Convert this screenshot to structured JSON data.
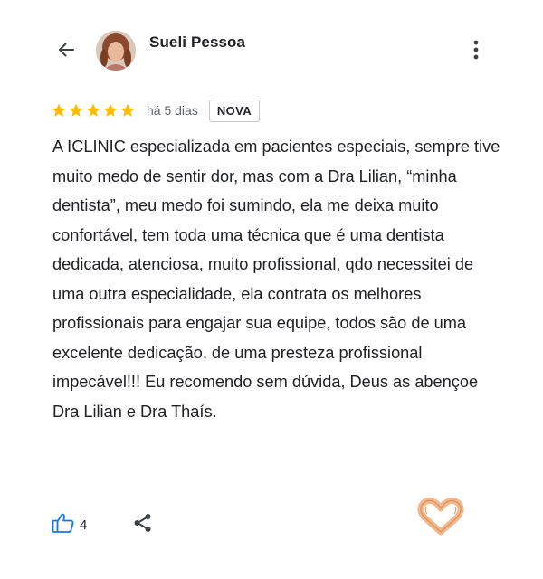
{
  "header": {
    "back_icon": "arrow-left-icon",
    "reviewer_name": "Sueli Pessoa",
    "more_icon": "more-vertical-icon"
  },
  "review": {
    "rating": 5,
    "rating_max": 5,
    "star_color": "#fbbc04",
    "time_ago": "há 5 dias",
    "badge": "NOVA",
    "text": "A ICLINIC especializada em pacientes especiais, sempre tive muito medo de sentir dor, mas com a Dra Lilian, “minha dentista”, meu medo foi sumindo, ela me deixa muito confortável, tem toda uma técnica que é uma dentista dedicada, atenciosa, muito profissional, qdo necessitei de uma outra especialidade, ela contrata os melhores profissionais para engajar sua equipe, todos são de uma excelente dedicação, de uma presteza profissional impecável!!! Eu recomendo sem dúvida, Deus as abençoe Dra Lilian e Dra Thaís."
  },
  "actions": {
    "like_icon": "thumbs-up-icon",
    "like_count": "4",
    "like_color": "#1a73e8",
    "share_icon": "share-icon",
    "reaction_icon": "heart-hands-icon"
  }
}
